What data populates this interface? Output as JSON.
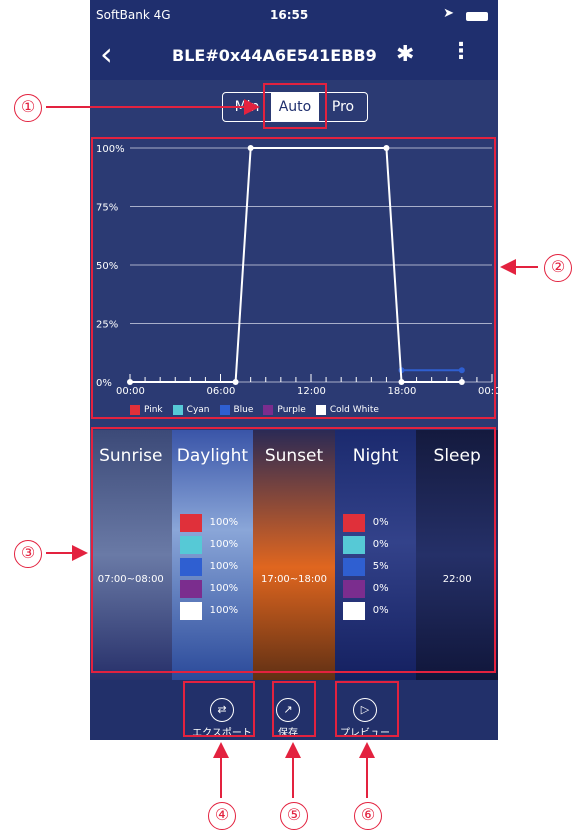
{
  "status_bar": {
    "carrier": "SoftBank 4G",
    "time": "16:55"
  },
  "nav": {
    "title": "BLE#0x44A6E541EBB9"
  },
  "mode_tabs": [
    "Min",
    "Auto",
    "Pro"
  ],
  "chart_data": {
    "type": "line",
    "x_ticks": [
      "00:00",
      "06:00",
      "12:00",
      "18:00",
      "00:00"
    ],
    "y_ticks": [
      "100%",
      "75%",
      "50%",
      "25%",
      "0%"
    ],
    "ylim": [
      0,
      100
    ],
    "series": [
      {
        "name": "Cold White",
        "color": "#ffffff",
        "x": [
          0,
          7,
          8,
          17,
          18,
          22
        ],
        "y": [
          0,
          0,
          100,
          100,
          0,
          0
        ]
      },
      {
        "name": "Blue",
        "color": "#2f5fd1",
        "x": [
          18,
          22
        ],
        "y": [
          5,
          5
        ]
      }
    ],
    "legend": [
      {
        "name": "Pink",
        "color": "#e0303a"
      },
      {
        "name": "Cyan",
        "color": "#56c9d6"
      },
      {
        "name": "Blue",
        "color": "#2f5fd1"
      },
      {
        "name": "Purple",
        "color": "#7b2d8e"
      },
      {
        "name": "Cold White",
        "color": "#ffffff"
      }
    ]
  },
  "phases": [
    {
      "name": "Sunrise",
      "time": "07:00~08:00",
      "bg": "linear-gradient(#3c4a78,#6a7aa6 50%,#27306a)"
    },
    {
      "name": "Daylight",
      "time": "",
      "bg": "linear-gradient(#3a55a8,#8aa6d8 40%,#2b4a9a)"
    },
    {
      "name": "Sunset",
      "time": "17:00~18:00",
      "bg": "linear-gradient(#2b2a55,#e0661f 55%,#603014)"
    },
    {
      "name": "Night",
      "time": "",
      "bg": "linear-gradient(#1b2a6e,#33428a 45%,#142060)"
    },
    {
      "name": "Sleep",
      "time": "22:00",
      "bg": "linear-gradient(#141a3e,#253068 50%,#10163a)"
    }
  ],
  "daylight_levels": [
    "100%",
    "100%",
    "100%",
    "100%",
    "100%"
  ],
  "night_levels": [
    "0%",
    "0%",
    "5%",
    "0%",
    "0%"
  ],
  "level_colors": [
    "#e0303a",
    "#56c9d6",
    "#2f5fd1",
    "#7b2d8e",
    "#ffffff"
  ],
  "actions": [
    {
      "label": "エクスポート"
    },
    {
      "label": "保存"
    },
    {
      "label": "プレビュー"
    }
  ],
  "callouts": [
    "①",
    "②",
    "③",
    "④",
    "⑤",
    "⑥"
  ]
}
